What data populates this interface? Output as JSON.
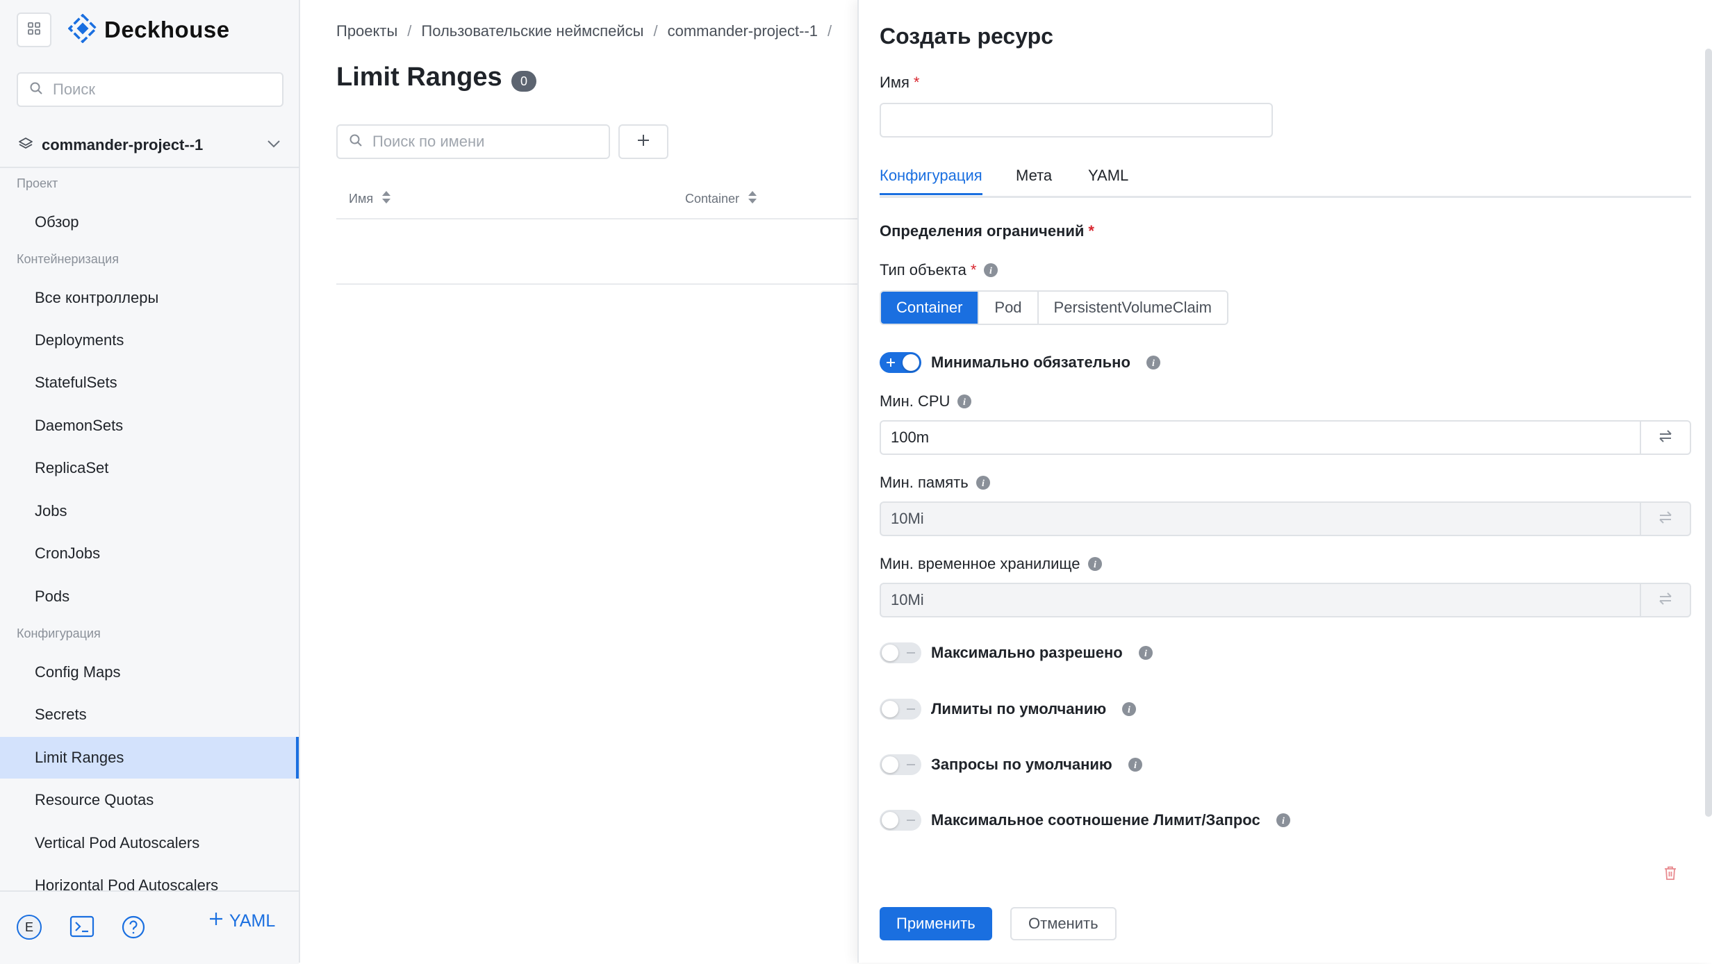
{
  "brand": {
    "name": "Deckhouse"
  },
  "sidebar": {
    "search_placeholder": "Поиск",
    "project": "commander-project--1",
    "sections": {
      "project": "Проект",
      "containerization": "Контейнеризация",
      "configuration": "Конфигурация"
    },
    "items": {
      "overview": "Обзор",
      "all_controllers": "Все контроллеры",
      "deployments": "Deployments",
      "statefulsets": "StatefulSets",
      "daemonsets": "DaemonSets",
      "replicaset": "ReplicaSet",
      "jobs": "Jobs",
      "cronjobs": "CronJobs",
      "pods": "Pods",
      "config_maps": "Config Maps",
      "secrets": "Secrets",
      "limit_ranges": "Limit Ranges",
      "resource_quotas": "Resource Quotas",
      "vpa": "Vertical Pod Autoscalers",
      "hpa": "Horizontal Pod Autoscalers"
    },
    "active_item": "Limit Ranges",
    "avatar_letter": "E",
    "yaml_button": "YAML"
  },
  "main": {
    "breadcrumb": [
      "Проекты",
      "Пользовательские неймспейсы",
      "commander-project--1"
    ],
    "title": "Limit Ranges",
    "count": "0",
    "search_placeholder": "Поиск по имени",
    "columns": [
      "Имя",
      "Container"
    ]
  },
  "panel": {
    "title": "Создать ресурс",
    "name_label": "Имя",
    "name_value": "",
    "tabs": [
      "Конфигурация",
      "Мета",
      "YAML"
    ],
    "active_tab": "Конфигурация",
    "limits_label": "Определения ограничений",
    "object_type_label": "Тип объекта",
    "object_types": [
      "Container",
      "Pod",
      "PersistentVolumeClaim"
    ],
    "selected_object_type": "Container",
    "min_required": {
      "label": "Минимально обязательно",
      "enabled": true
    },
    "min_cpu": {
      "label": "Мин. CPU",
      "value": "100m"
    },
    "min_memory": {
      "label": "Мин. память",
      "value": "10Mi"
    },
    "min_ephemeral": {
      "label": "Мин. временное хранилище",
      "value": "10Mi"
    },
    "toggles": [
      {
        "label": "Максимально разрешено",
        "enabled": false
      },
      {
        "label": "Лимиты по умолчанию",
        "enabled": false
      },
      {
        "label": "Запросы по умолчанию",
        "enabled": false
      },
      {
        "label": "Максимальное соотношение Лимит/Запрос",
        "enabled": false
      }
    ],
    "apply_button": "Применить",
    "cancel_button": "Отменить"
  },
  "colors": {
    "accent": "#1a6fe0",
    "active_nav_bg": "#d3e2fc",
    "required": "#d8262f",
    "delete": "#e88a8f"
  }
}
